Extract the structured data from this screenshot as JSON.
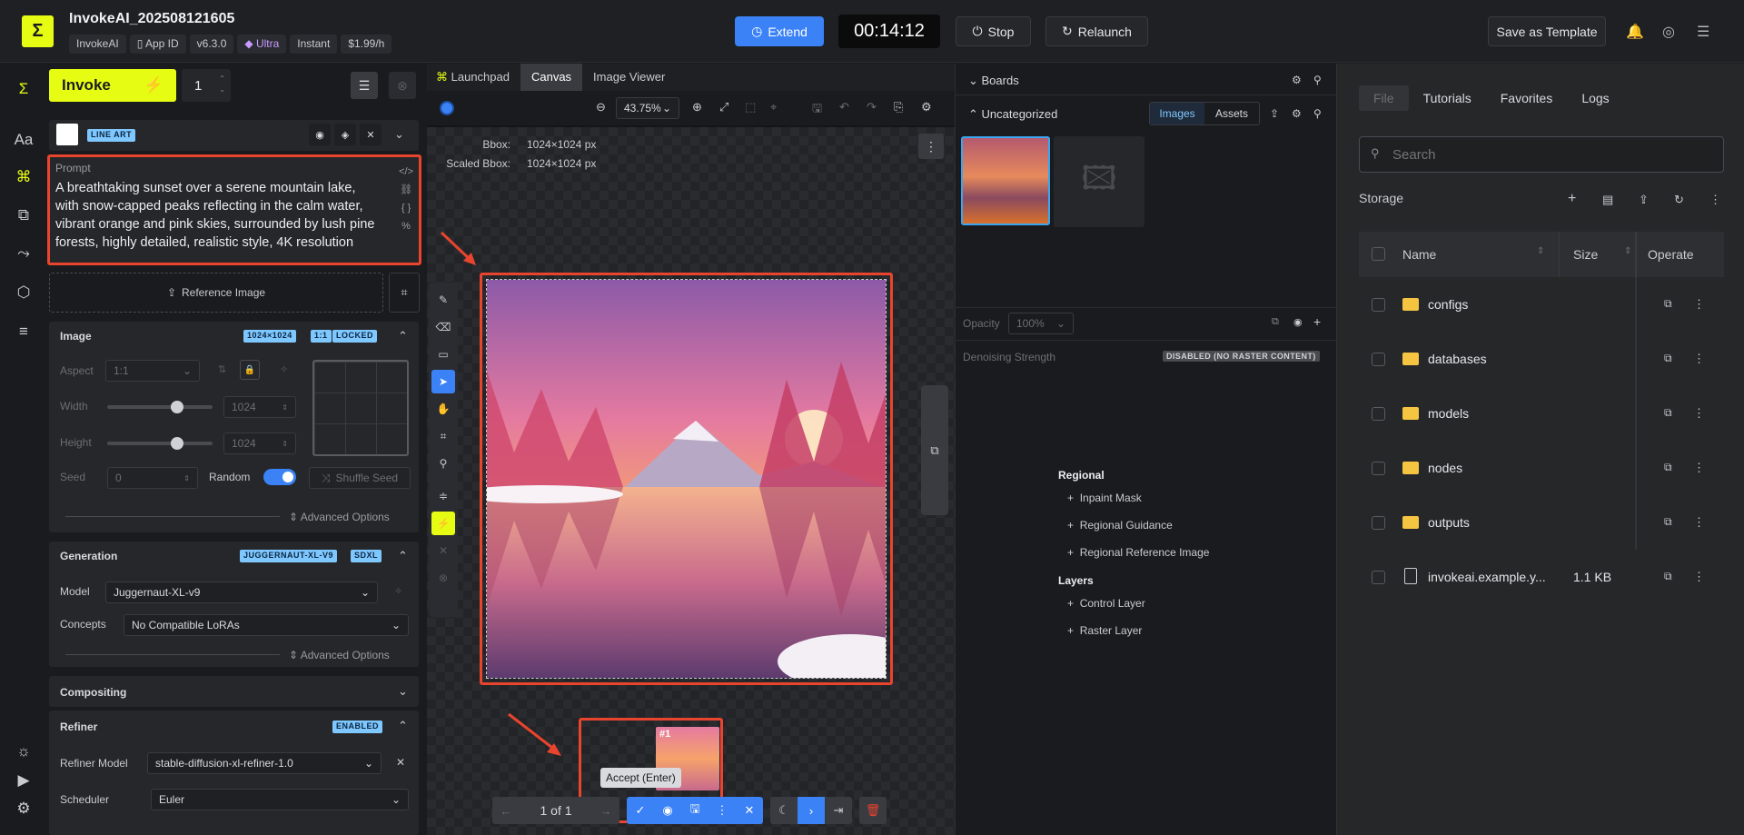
{
  "header": {
    "app_title": "InvokeAI_202508121605",
    "chips": [
      "InvokeAI",
      "App ID",
      "v6.3.0",
      "Ultra",
      "Instant",
      "$1.99/h"
    ],
    "extend_label": "Extend",
    "timer": "00:14:12",
    "stop_label": "Stop",
    "relaunch_label": "Relaunch",
    "save_template_label": "Save as Template"
  },
  "left_panel": {
    "invoke_label": "Invoke",
    "batch_count": "1",
    "layer_badge": "LINE ART",
    "prompt_label": "Prompt",
    "prompt_text": "A breathtaking sunset over a serene mountain lake, with snow-capped peaks reflecting in the calm water, vibrant orange and pink skies, surrounded by lush pine forests, highly detailed, realistic style, 4K resolution",
    "reference_image_label": "Reference Image",
    "image_section": {
      "title": "Image",
      "tags": [
        "1024×1024",
        "1:1",
        "LOCKED"
      ],
      "aspect_label": "Aspect",
      "aspect_value": "1:1",
      "width_label": "Width",
      "width_value": "1024",
      "height_label": "Height",
      "height_value": "1024",
      "seed_label": "Seed",
      "seed_value": "0",
      "random_label": "Random",
      "shuffle_label": "Shuffle Seed",
      "advanced_label": "Advanced Options"
    },
    "generation_section": {
      "title": "Generation",
      "tags": [
        "JUGGERNAUT-XL-V9",
        "SDXL"
      ],
      "model_label": "Model",
      "model_value": "Juggernaut-XL-v9",
      "concepts_label": "Concepts",
      "concepts_value": "No Compatible LoRAs",
      "advanced_label": "Advanced Options"
    },
    "compositing_title": "Compositing",
    "refiner_section": {
      "title": "Refiner",
      "tag": "ENABLED",
      "model_label": "Refiner Model",
      "model_value": "stable-diffusion-xl-refiner-1.0",
      "scheduler_label": "Scheduler",
      "scheduler_value": "Euler"
    }
  },
  "center": {
    "tabs": [
      "Launchpad",
      "Canvas",
      "Image Viewer"
    ],
    "zoom": "43.75%",
    "bbox_label": "Bbox:",
    "bbox_value": "1024×1024 px",
    "scaled_bbox_label": "Scaled Bbox:",
    "scaled_bbox_value": "1024×1024 px",
    "staging_index": "#1",
    "pagination": "1 of 1",
    "tooltip": "Accept (Enter)"
  },
  "boards": {
    "title": "Boards",
    "uncategorized": "Uncategorized",
    "images_tab": "Images",
    "assets_tab": "Assets",
    "opacity_label": "Opacity",
    "opacity_value": "100%",
    "denoise_label": "Denoising Strength",
    "denoise_badge": "DISABLED (NO RASTER CONTENT)",
    "regional_heading": "Regional",
    "regional_items": [
      "Inpaint Mask",
      "Regional Guidance",
      "Regional Reference Image"
    ],
    "layers_heading": "Layers",
    "layer_items": [
      "Control Layer",
      "Raster Layer"
    ]
  },
  "files": {
    "tabs": [
      "File",
      "Tutorials",
      "Favorites",
      "Logs"
    ],
    "search_placeholder": "Search",
    "storage_label": "Storage",
    "columns": {
      "name": "Name",
      "size": "Size",
      "operate": "Operate"
    },
    "rows": [
      {
        "name": "configs",
        "size": "",
        "type": "folder"
      },
      {
        "name": "databases",
        "size": "",
        "type": "folder"
      },
      {
        "name": "models",
        "size": "",
        "type": "folder"
      },
      {
        "name": "nodes",
        "size": "",
        "type": "folder"
      },
      {
        "name": "outputs",
        "size": "",
        "type": "folder"
      },
      {
        "name": "invokeai.example.y...",
        "size": "1.1 KB",
        "type": "file"
      }
    ]
  },
  "colors": {
    "accent": "#e6fd13",
    "blue": "#3b82f6",
    "highlight": "#e8442e"
  }
}
